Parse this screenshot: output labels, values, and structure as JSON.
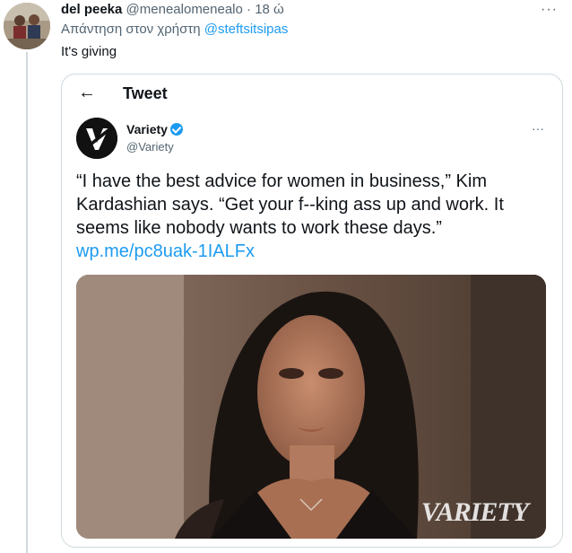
{
  "reply": {
    "author_name": "del peeka",
    "author_handle": "@menealomenealo",
    "separator": "·",
    "time": "18 ώ",
    "more": "···",
    "reply_prefix": "Απάντηση στον χρήστη",
    "reply_mention": "@steftsitsipas",
    "text": "It's giving"
  },
  "card": {
    "back_icon": "←",
    "title": "Tweet",
    "quoted": {
      "name": "Variety",
      "handle": "@Variety",
      "more": "···",
      "text": "“I have the best advice for women in business,” Kim Kardashian says. “Get your f--king ass up and work. It seems like nobody wants to work these days.”",
      "link": "wp.me/pc8uak-1IALFx",
      "media_watermark": "VARIETY"
    }
  },
  "colors": {
    "accent": "#1d9bf0",
    "text": "#0f1419",
    "muted": "#536471",
    "border": "#cfd9de"
  }
}
